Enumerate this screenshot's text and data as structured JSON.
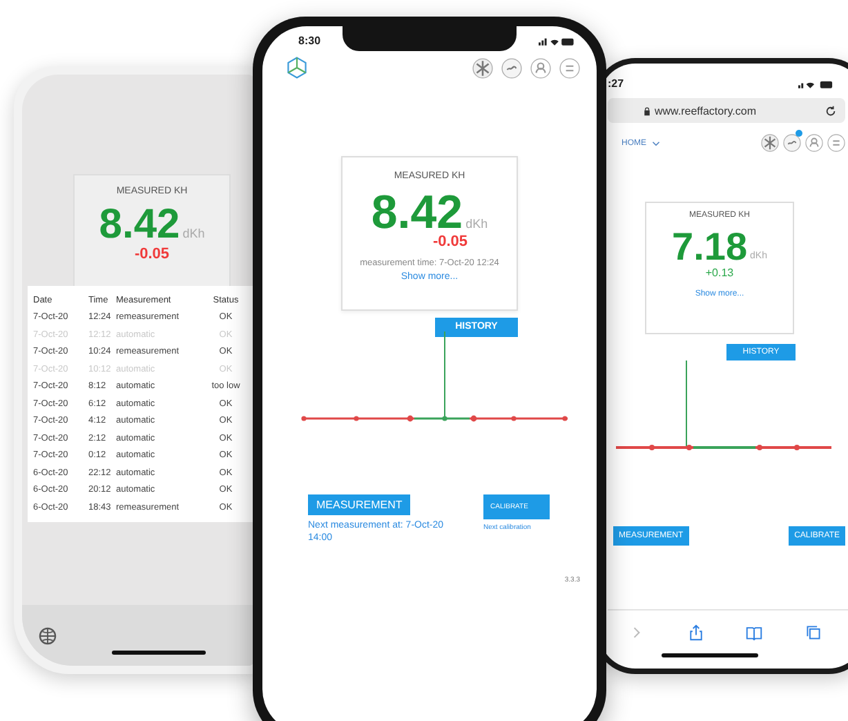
{
  "left_phone": {
    "card": {
      "title": "MEASURED KH",
      "value": "8.42",
      "unit": "dKh",
      "change": "-0.05",
      "color": "#f03a3a"
    },
    "history_table": {
      "columns": [
        "Date",
        "Time",
        "Measurement",
        "Status"
      ],
      "rows": [
        {
          "cells": [
            "7-Oct-20",
            "12:24",
            "remeasurement",
            "OK"
          ],
          "dimmed": false
        },
        {
          "cells": [
            "7-Oct-20",
            "12:12",
            "automatic",
            "OK"
          ],
          "dimmed": true
        },
        {
          "cells": [
            "7-Oct-20",
            "10:24",
            "remeasurement",
            "OK"
          ],
          "dimmed": false
        },
        {
          "cells": [
            "7-Oct-20",
            "10:12",
            "automatic",
            "OK"
          ],
          "dimmed": true
        },
        {
          "cells": [
            "7-Oct-20",
            "8:12",
            "automatic",
            "too low"
          ],
          "dimmed": false
        },
        {
          "cells": [
            "7-Oct-20",
            "6:12",
            "automatic",
            "OK"
          ],
          "dimmed": false
        },
        {
          "cells": [
            "7-Oct-20",
            "4:12",
            "automatic",
            "OK"
          ],
          "dimmed": false
        },
        {
          "cells": [
            "7-Oct-20",
            "2:12",
            "automatic",
            "OK"
          ],
          "dimmed": false
        },
        {
          "cells": [
            "7-Oct-20",
            "0:12",
            "automatic",
            "OK"
          ],
          "dimmed": false
        },
        {
          "cells": [
            "6-Oct-20",
            "22:12",
            "automatic",
            "OK"
          ],
          "dimmed": false
        },
        {
          "cells": [
            "6-Oct-20",
            "20:12",
            "automatic",
            "OK"
          ],
          "dimmed": false
        },
        {
          "cells": [
            "6-Oct-20",
            "18:43",
            "remeasurement",
            "OK"
          ],
          "dimmed": false
        }
      ]
    }
  },
  "center_phone": {
    "status_time": "8:30",
    "card": {
      "title": "MEASURED KH",
      "value": "8.42",
      "unit": "dKh",
      "change": "-0.05",
      "color": "#f03a3a",
      "measurement_time": "measurement time: 7-Oct-20 12:24",
      "link": "Show more..."
    },
    "history_button": "HISTORY",
    "measure_button": "MEASUREMENT",
    "next_measurement": "Next measurement at: 7-Oct-20 14:00",
    "calibrate_button": "CALIBRATE",
    "next_calibration": "Next calibration",
    "version": "3.3.3"
  },
  "right_phone": {
    "status_time": ":27",
    "url": "www.reeffactory.com",
    "nav_label": "HOME",
    "card": {
      "title": "MEASURED KH",
      "value": "7.18",
      "unit": "dKh",
      "change": "+0.13",
      "color": "#2aa84a",
      "link": "Show more..."
    },
    "history_button": "HISTORY",
    "measure_button": "MEASUREMENT",
    "calibrate_button": "CALIBRATE"
  }
}
